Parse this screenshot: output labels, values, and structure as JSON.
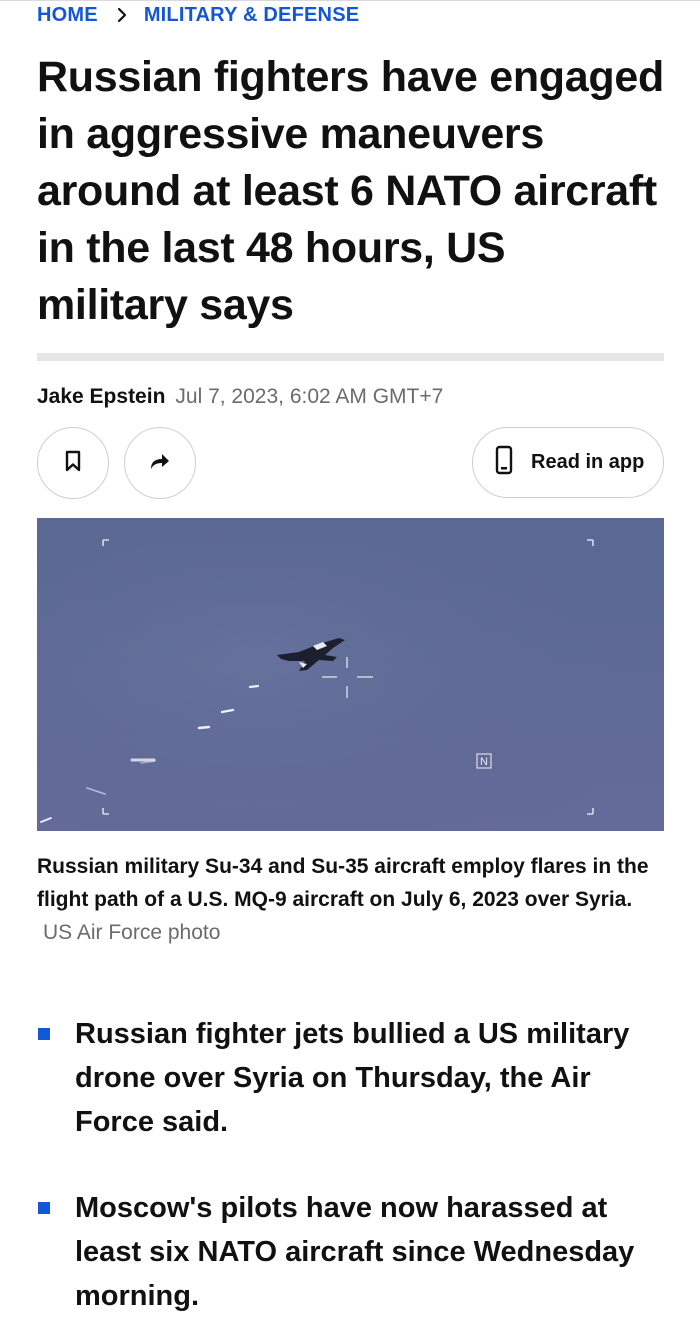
{
  "breadcrumb": {
    "home": "HOME",
    "section": "MILITARY & DEFENSE"
  },
  "article": {
    "headline": "Russian fighters have engaged in aggressive maneuvers around at least 6 NATO aircraft in the last 48 hours, US military says",
    "author": "Jake Epstein",
    "date": "Jul 7, 2023, 6:02 AM GMT+7"
  },
  "actions": {
    "bookmark_icon": "bookmark-icon",
    "share_icon": "share-arrow-icon",
    "phone_icon": "phone-icon",
    "read_in_app": "Read in app"
  },
  "image": {
    "hud_marker": "N",
    "caption": "Russian military Su-34 and Su-35 aircraft employ flares in the flight path of a U.S. MQ-9 aircraft on July 6, 2023 over Syria.",
    "credit": "US Air Force photo"
  },
  "bullets": [
    "Russian fighter jets bullied a US military drone over Syria on Thursday, the Air Force said.",
    "Moscow's pilots have now harassed at least six NATO aircraft since Wednesday morning."
  ],
  "colors": {
    "accent": "#1357d6",
    "text": "#111111",
    "muted": "#6b6b6b",
    "sky": "#5d6b96"
  }
}
